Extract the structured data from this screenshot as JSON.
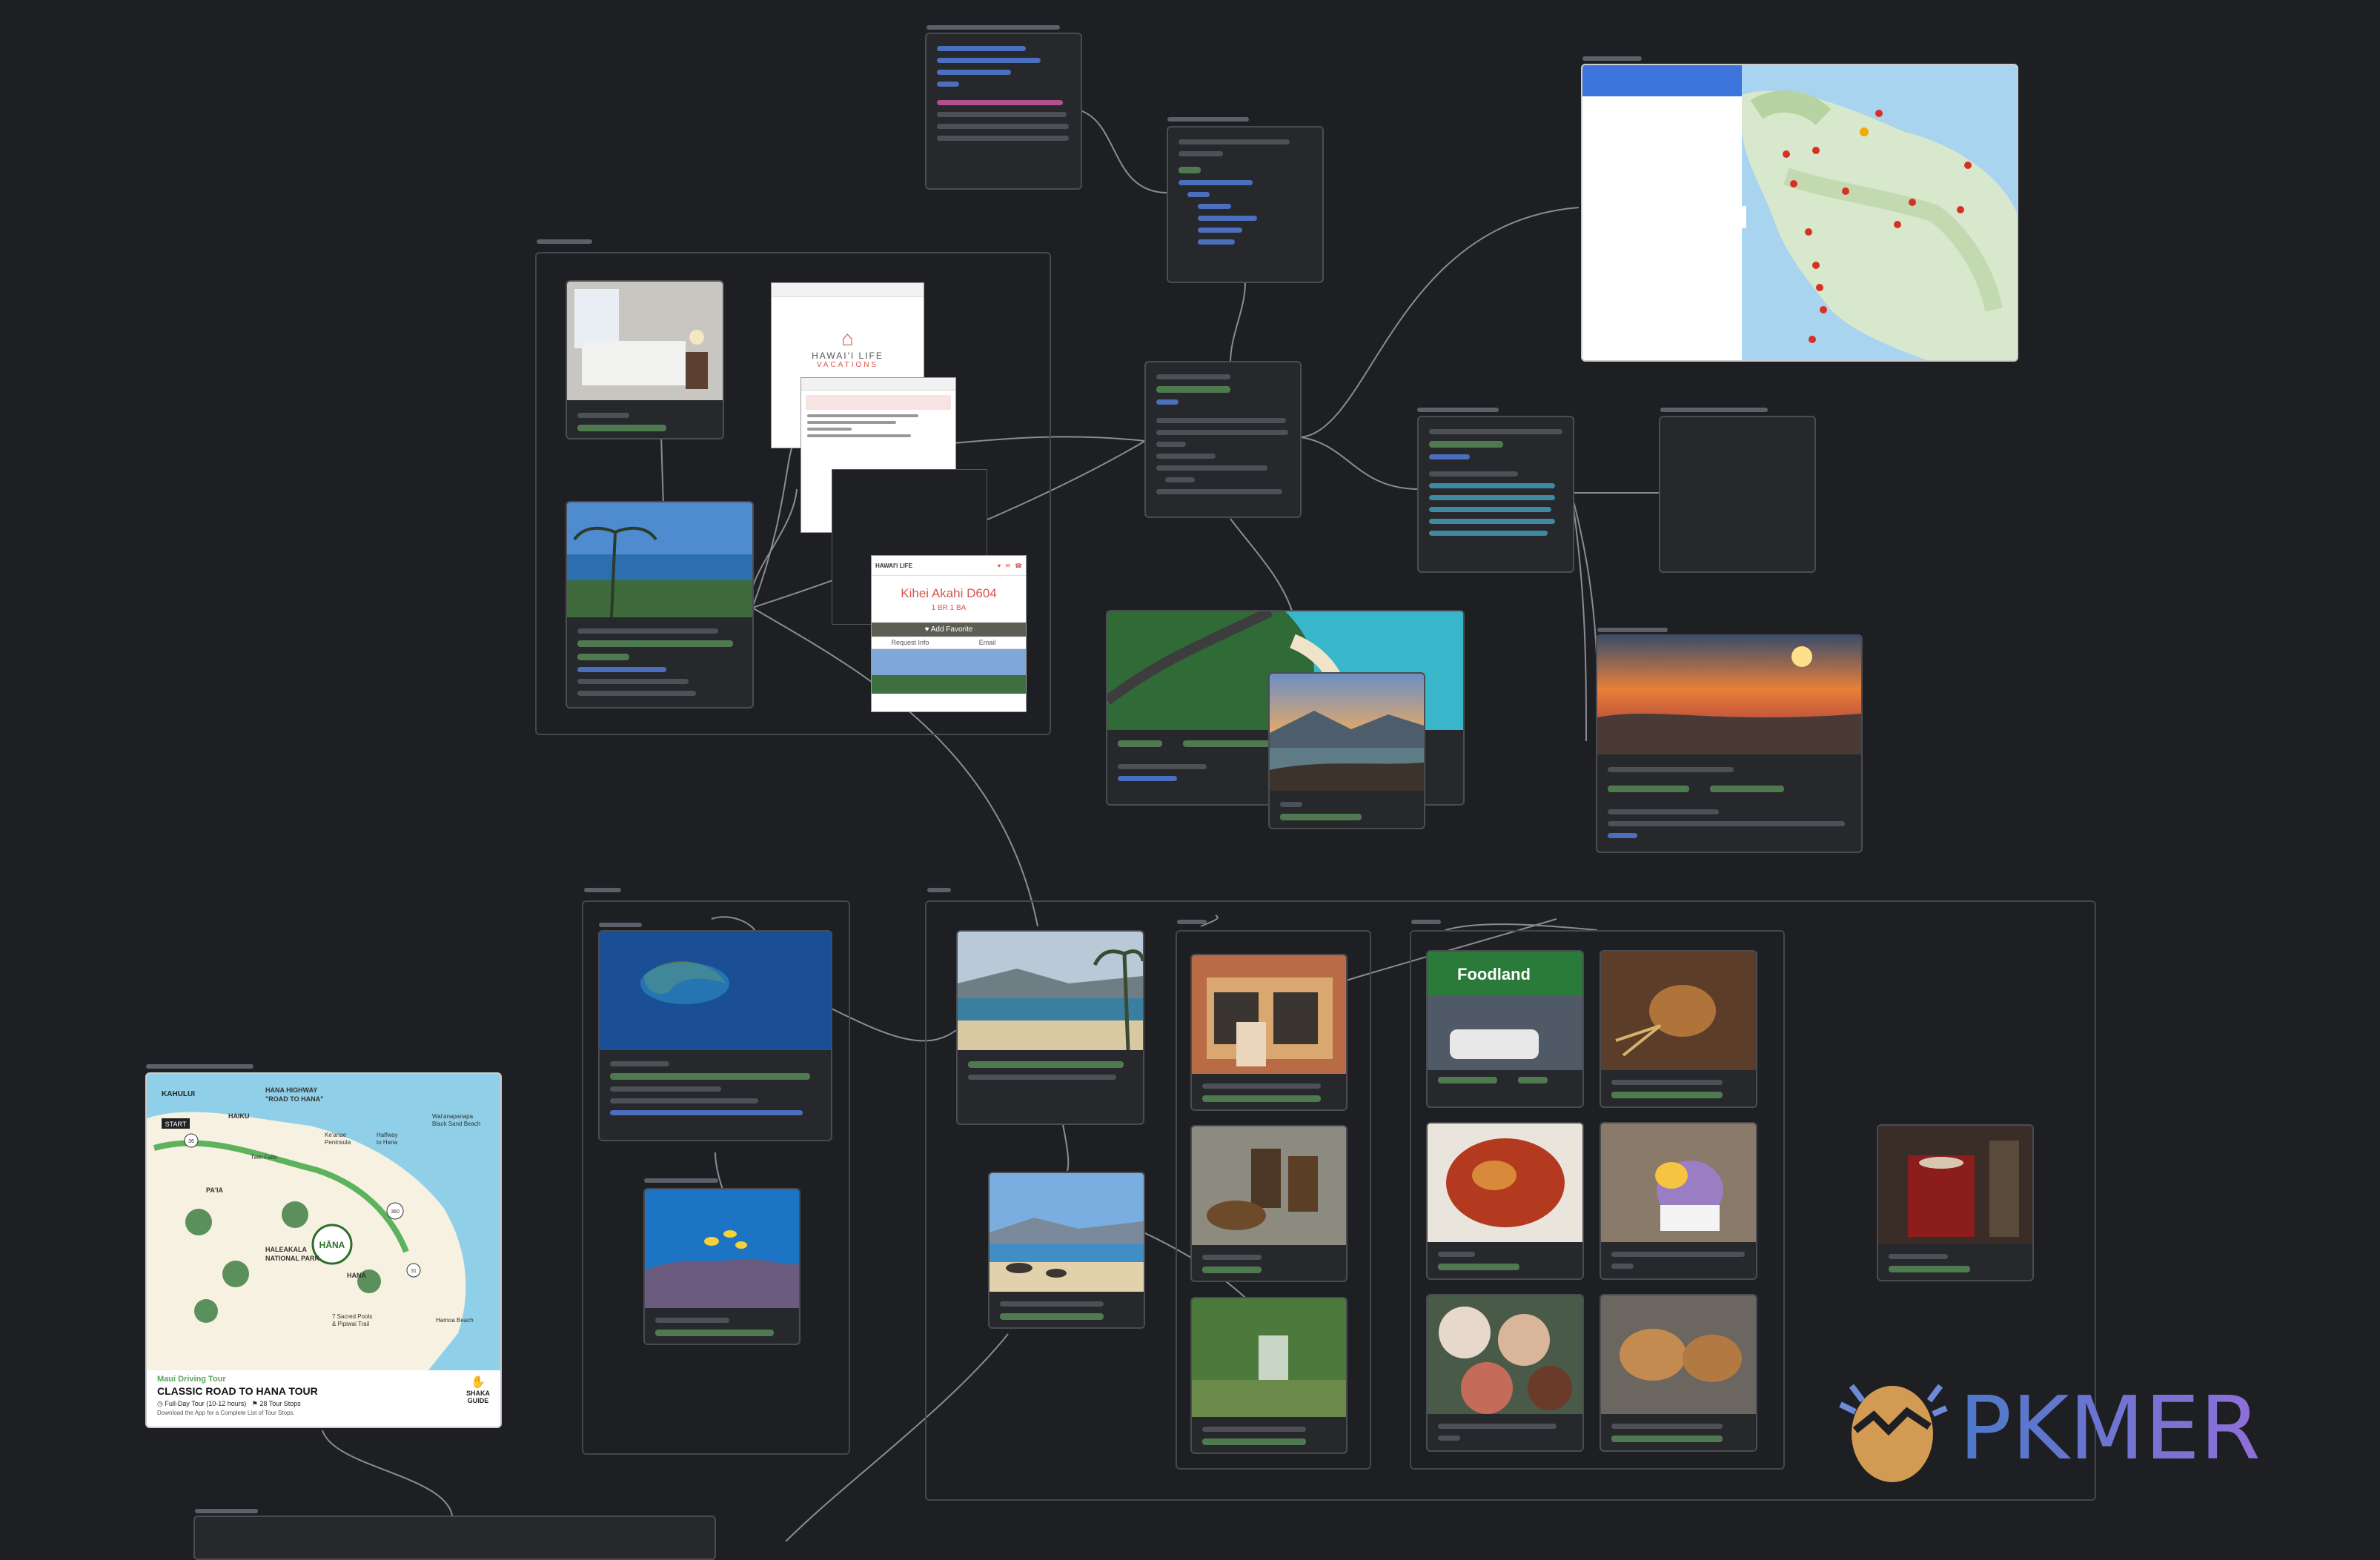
{
  "roadmap": {
    "region": "Maui Driving Tour",
    "title": "CLASSIC ROAD TO HANA TOUR",
    "meta": "Full-Day Tour (10-12 hours)",
    "stops": "28 Tour Stops",
    "download": "Download the App for a Complete List of Tour Stops.",
    "brand_line1": "SHAKA",
    "brand_line2": "GUIDE",
    "map_labels": {
      "kahului": "KAHULUI",
      "start": "START",
      "highway_line1": "HANA HIGHWAY",
      "highway_line2": "\"ROAD TO HANA\"",
      "haiku": "HAIKU",
      "keanae_line1": "Ke'anae",
      "keanae_line2": "Peninsula",
      "halfway_line1": "Halfway",
      "halfway_line2": "to Hana",
      "waianapanapa_line1": "Wai'anapanapa",
      "waianapanapa_line2": "Black Sand Beach",
      "twin_falls": "Twin Falls",
      "paia": "PA'IA",
      "haleakala_line1": "HALEAKALA",
      "haleakala_line2": "NATIONAL PARK",
      "hana_sign": "HĀNA",
      "hana": "HANA",
      "pools_line1": "7 Sacred Pools",
      "pools_line2": "& Pipiwai Trail",
      "hamoa": "Hamoa Beach",
      "mile_36": "36",
      "mile_360": "360",
      "mile_31": "31"
    }
  },
  "listing": {
    "brand": "HAWAI'I LIFE",
    "title": "Kihei Akahi D604",
    "subtitle": "1 BR 1 BA",
    "favorite": "Add Favorite",
    "request": "Request Info",
    "email": "Email"
  },
  "hawaii_life_doc": {
    "brand": "HAWAI'I LIFE",
    "brand_sub": "VACATIONS"
  },
  "foodland_sign": "Foodland",
  "watermark": "PKMER",
  "colors": {
    "canvas": "#1e1f22",
    "card": "#26282c",
    "green_tag": "#4f7a4f",
    "link": "#4b6fbd",
    "listing_red": "#d9534f"
  }
}
